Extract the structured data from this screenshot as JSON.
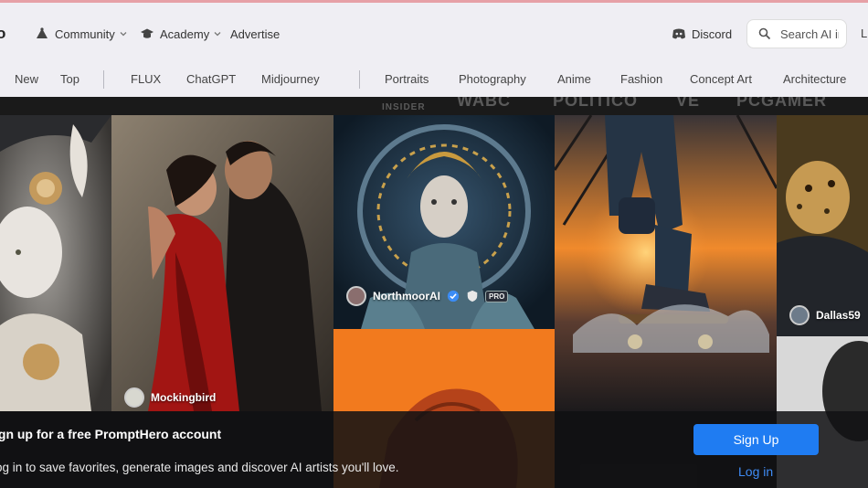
{
  "header": {
    "logo_fragment": "o",
    "nav": [
      {
        "label": "Community",
        "icon": "community-icon",
        "has_dropdown": true
      },
      {
        "label": "Academy",
        "icon": "graduation-cap-icon",
        "has_dropdown": true
      },
      {
        "label": "Advertise",
        "icon": "",
        "has_dropdown": false
      }
    ],
    "discord_label": "Discord",
    "search_placeholder": "Search AI im",
    "edge_fragment": "L"
  },
  "categories": {
    "group1": [
      "New",
      "Top"
    ],
    "group2": [
      "FLUX",
      "ChatGPT",
      "Midjourney"
    ],
    "group3": [
      "Portraits",
      "Photography",
      "Anime",
      "Fashion",
      "Concept Art",
      "Architecture"
    ]
  },
  "brands": [
    "INSIDER",
    "WABC",
    "POLITICO",
    "VE",
    "PCGAMER"
  ],
  "gallery": {
    "authors": [
      {
        "name": "Mockingbird"
      },
      {
        "name": "NorthmoorAI",
        "verified": true,
        "pro_label": "PRO"
      },
      {
        "name": "Dallas59"
      }
    ]
  },
  "signup": {
    "title": "ign up for a free PromptHero account",
    "subtitle": "og in to save favorites, generate images and discover AI artists you'll love.",
    "button": "Sign Up",
    "login": "Log in"
  },
  "colors": {
    "accent": "#1f7cf2",
    "link": "#3f8cf5",
    "header_bg": "#efeef3"
  }
}
